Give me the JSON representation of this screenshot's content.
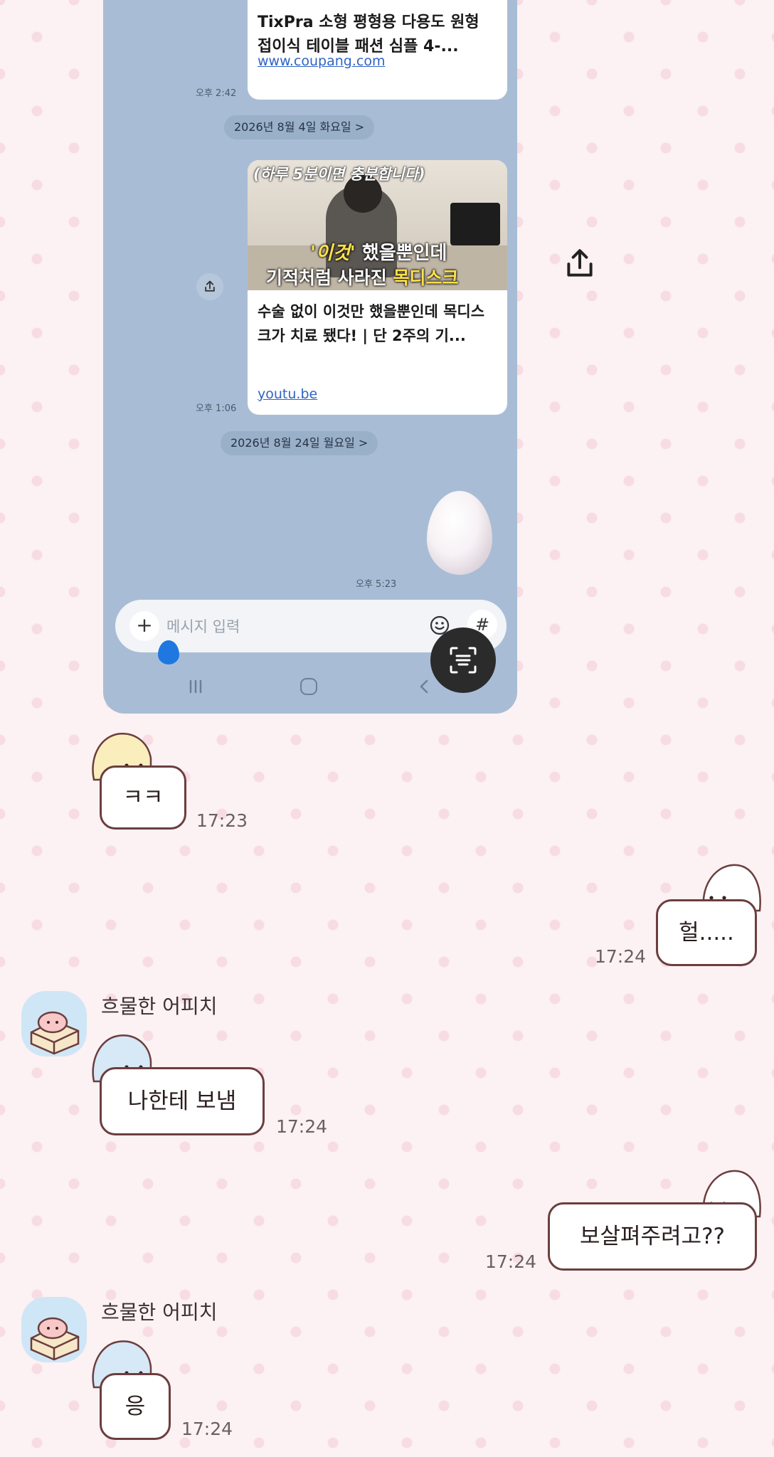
{
  "embedded_screenshot": {
    "card1": {
      "title": "TixPra 소형 평형용 다용도 원형 접이식 테이블 패션 심플 4-...",
      "link": "www.coupang.com"
    },
    "card1_time": "오후 2:42",
    "date_divider_1": "2026년 8월 4일 화요일 >",
    "card2": {
      "thumbnail_top_caption": "(하루 5분이면 충분합니다)",
      "thumbnail_caption_line1_highlight": "'이것'",
      "thumbnail_caption_line1_rest": "했을뿐인데",
      "thumbnail_caption_line2_rest": "기적처럼 사라진",
      "thumbnail_caption_line2_highlight": "목디스크",
      "title": "수술 없이 이것만 했을뿐인데 목디스크가 치료 됐다! | 단 2주의 기...",
      "link": "youtu.be"
    },
    "card2_time": "오후 1:06",
    "date_divider_2": "2026년 8월 24일 월요일 >",
    "egg_time": "오후 5:23",
    "input_placeholder": "메시지 입력",
    "hash_label": "#",
    "plus_label": "+"
  },
  "messages": [
    {
      "side": "left",
      "text": "ㅋㅋ",
      "time": "17:23"
    },
    {
      "side": "right",
      "text": "헐.....",
      "time": "17:24"
    },
    {
      "side": "left",
      "sender": "흐물한 어피치",
      "text": "나한테 보냄",
      "time": "17:24"
    },
    {
      "side": "right",
      "text": "보살펴주려고??",
      "time": "17:24"
    },
    {
      "side": "left",
      "sender": "흐물한 어피치",
      "text": "응",
      "time": "17:24"
    }
  ],
  "colors": {
    "background": "#fcf1f3",
    "dots": "#f7dde3",
    "bubble_border": "#6b3e3e",
    "inner_chat_bg": "#a8bdd5",
    "link": "#2f64c5"
  },
  "icons": [
    "share-icon",
    "scan-text-icon",
    "emoji-icon",
    "recent-apps-icon",
    "home-icon",
    "back-icon"
  ]
}
